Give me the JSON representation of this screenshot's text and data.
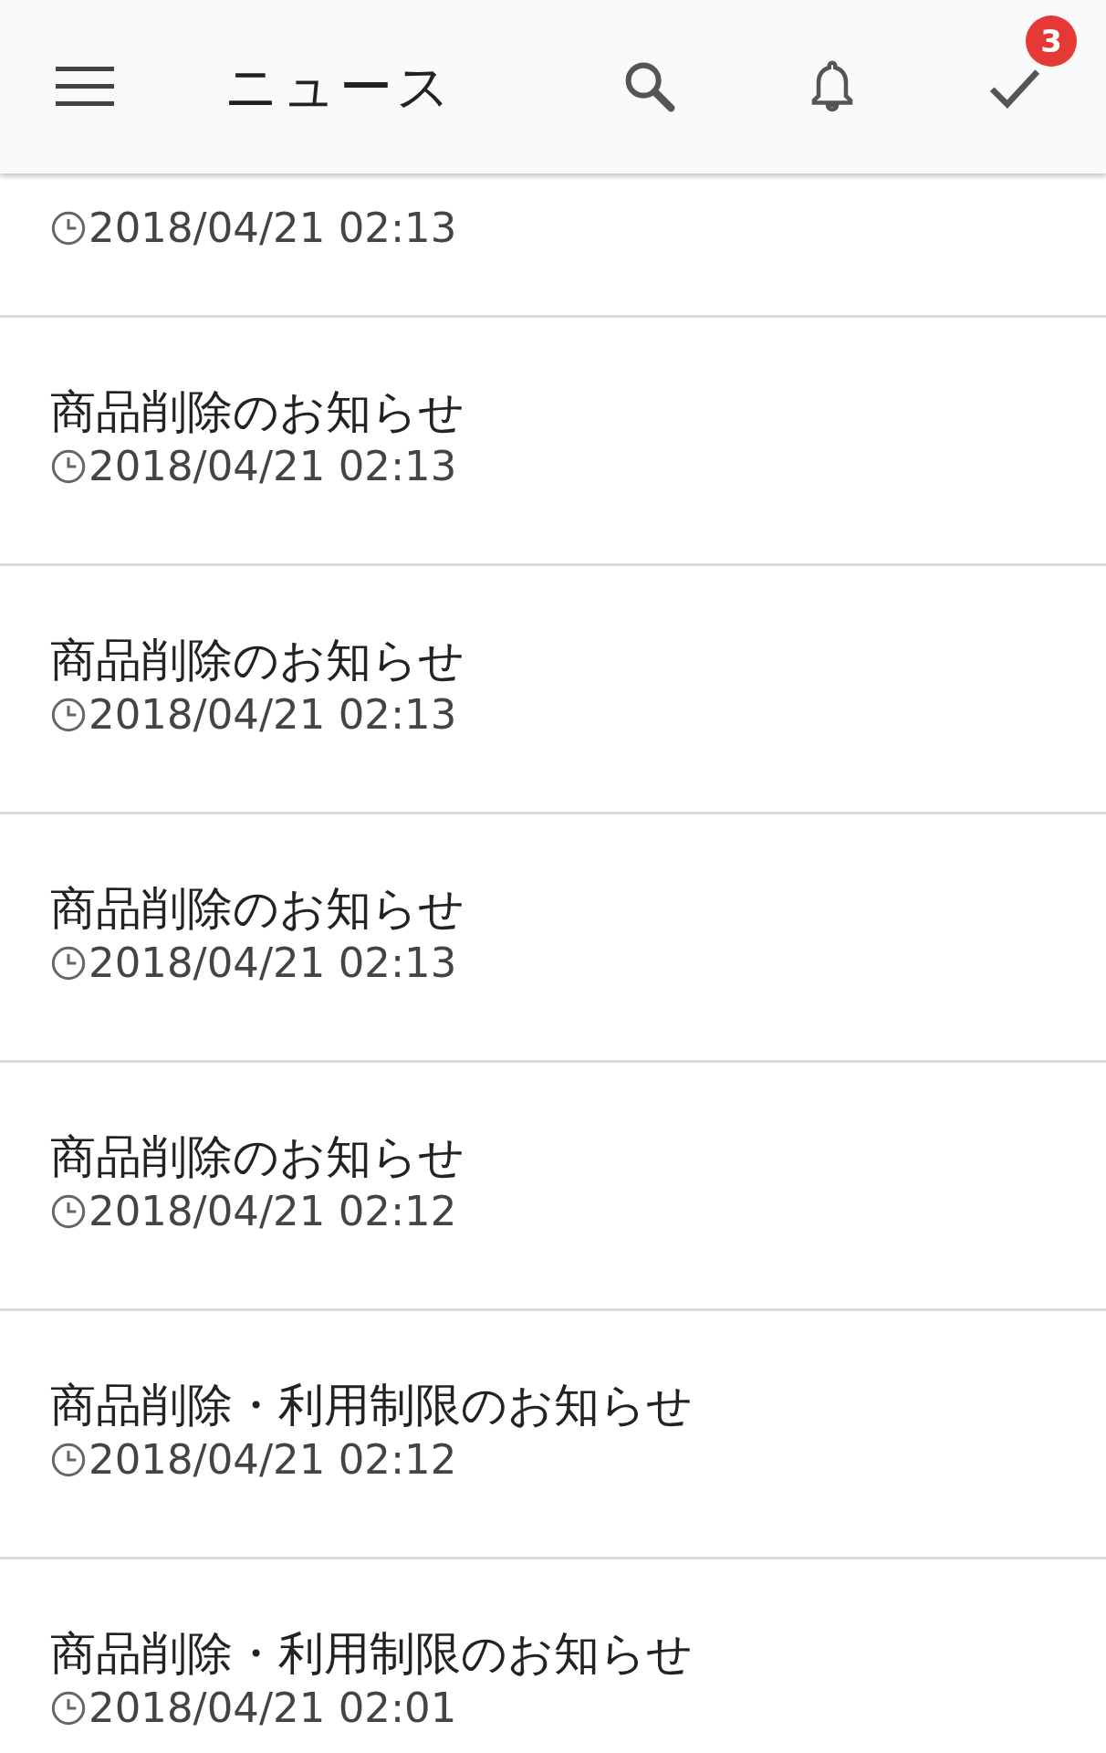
{
  "header": {
    "title": "ニュース",
    "badge": "3"
  },
  "news": [
    {
      "time": "2018/04/21 02:13"
    },
    {
      "title": "商品削除のお知らせ",
      "time": "2018/04/21 02:13"
    },
    {
      "title": "商品削除のお知らせ",
      "time": "2018/04/21 02:13"
    },
    {
      "title": "商品削除のお知らせ",
      "time": "2018/04/21 02:13"
    },
    {
      "title": "商品削除のお知らせ",
      "time": "2018/04/21 02:12"
    },
    {
      "title": "商品削除・利用制限のお知らせ",
      "time": "2018/04/21 02:12"
    },
    {
      "title": "商品削除・利用制限のお知らせ",
      "time": "2018/04/21 02:01"
    }
  ]
}
